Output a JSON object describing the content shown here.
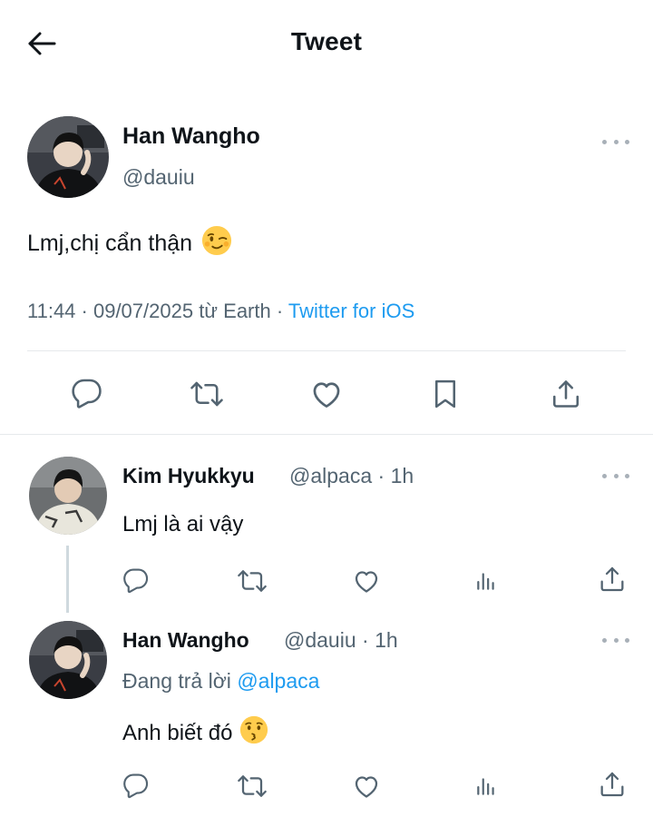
{
  "header": {
    "title": "Tweet",
    "back_icon": "arrow-left-icon"
  },
  "main_tweet": {
    "author_name": "Han Wangho",
    "handle": "@dauiu",
    "text": "Lmj,chị cẩn thận",
    "emoji": "winking-face",
    "meta_prefix": "11:44 · 09/07/2025 từ Earth · ",
    "source": "Twitter for iOS",
    "actions": [
      "reply-icon",
      "retweet-icon",
      "like-icon",
      "bookmark-icon",
      "share-icon"
    ]
  },
  "replies": [
    {
      "author_name": "Kim Hyukkyu",
      "handle_time": "@alpaca · 1h",
      "text": "Lmj là ai vậy",
      "actions": [
        "reply-icon",
        "retweet-icon",
        "like-icon",
        "views-icon",
        "share-icon"
      ]
    },
    {
      "author_name": "Han Wangho",
      "handle_time": "@dauiu · 1h",
      "replying_prefix": "Đang trả lời ",
      "replying_to": "@alpaca",
      "text": "Anh biết đó",
      "emoji": "kissing-face",
      "actions": [
        "reply-icon",
        "retweet-icon",
        "like-icon",
        "views-icon",
        "share-icon"
      ]
    }
  ],
  "colors": {
    "accent": "#1d9bf0",
    "text": "#0f1419",
    "secondary": "#536471",
    "divider": "#e6e9ec",
    "icon": "#536471"
  }
}
